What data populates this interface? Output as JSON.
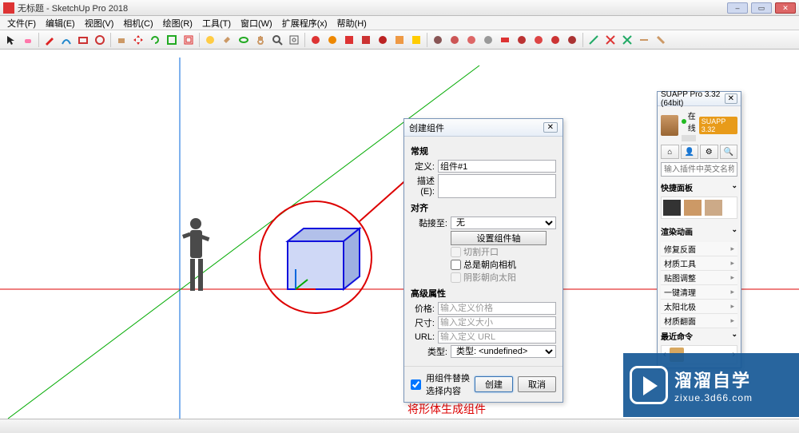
{
  "window": {
    "title": "无标题 - SketchUp Pro 2018",
    "min": "–",
    "max": "▭",
    "close": "✕"
  },
  "menu": [
    "文件(F)",
    "编辑(E)",
    "视图(V)",
    "相机(C)",
    "绘图(R)",
    "工具(T)",
    "窗口(W)",
    "扩展程序(x)",
    "帮助(H)"
  ],
  "annotation": "将形体生成组件",
  "dialog": {
    "title": "创建组件",
    "close": "✕",
    "section_general": "常规",
    "def_label": "定义:",
    "def_value": "组件#1",
    "desc_label": "描述(E):",
    "section_align": "对齐",
    "glue_label": "黏接至:",
    "glue_value": "无",
    "axis_button": "设置组件轴",
    "cb_cut": "切割开口",
    "cb_face_camera": "总是朝向相机",
    "cb_shadow": "阴影朝向太阳",
    "section_adv": "高级属性",
    "price_label": "价格:",
    "price_ph": "输入定义价格",
    "size_label": "尺寸:",
    "size_ph": "输入定义大小",
    "url_label": "URL:",
    "url_ph": "输入定义 URL",
    "type_label": "类型:",
    "type_value": "类型: <undefined>",
    "replace_cb": "用组件替换选择内容",
    "ok": "创建",
    "cancel": "取消"
  },
  "suapp": {
    "title": "SUAPP Pro 3.32 (64bit)",
    "close": "✕",
    "user_status": "在线",
    "user_name": "",
    "badge": "SUAPP 3.32",
    "search_ph": "输入插件中英文名称搜索",
    "section_quick": "快捷面板",
    "section_render": "渲染动画",
    "items": [
      "修复反面",
      "材质工具",
      "贴图调整",
      "一键清理",
      "太阳北极",
      "材质翻面"
    ],
    "section_recent": "最近命令"
  },
  "watermark": {
    "big": "溜溜自学",
    "small": "zixue.3d66.com"
  }
}
